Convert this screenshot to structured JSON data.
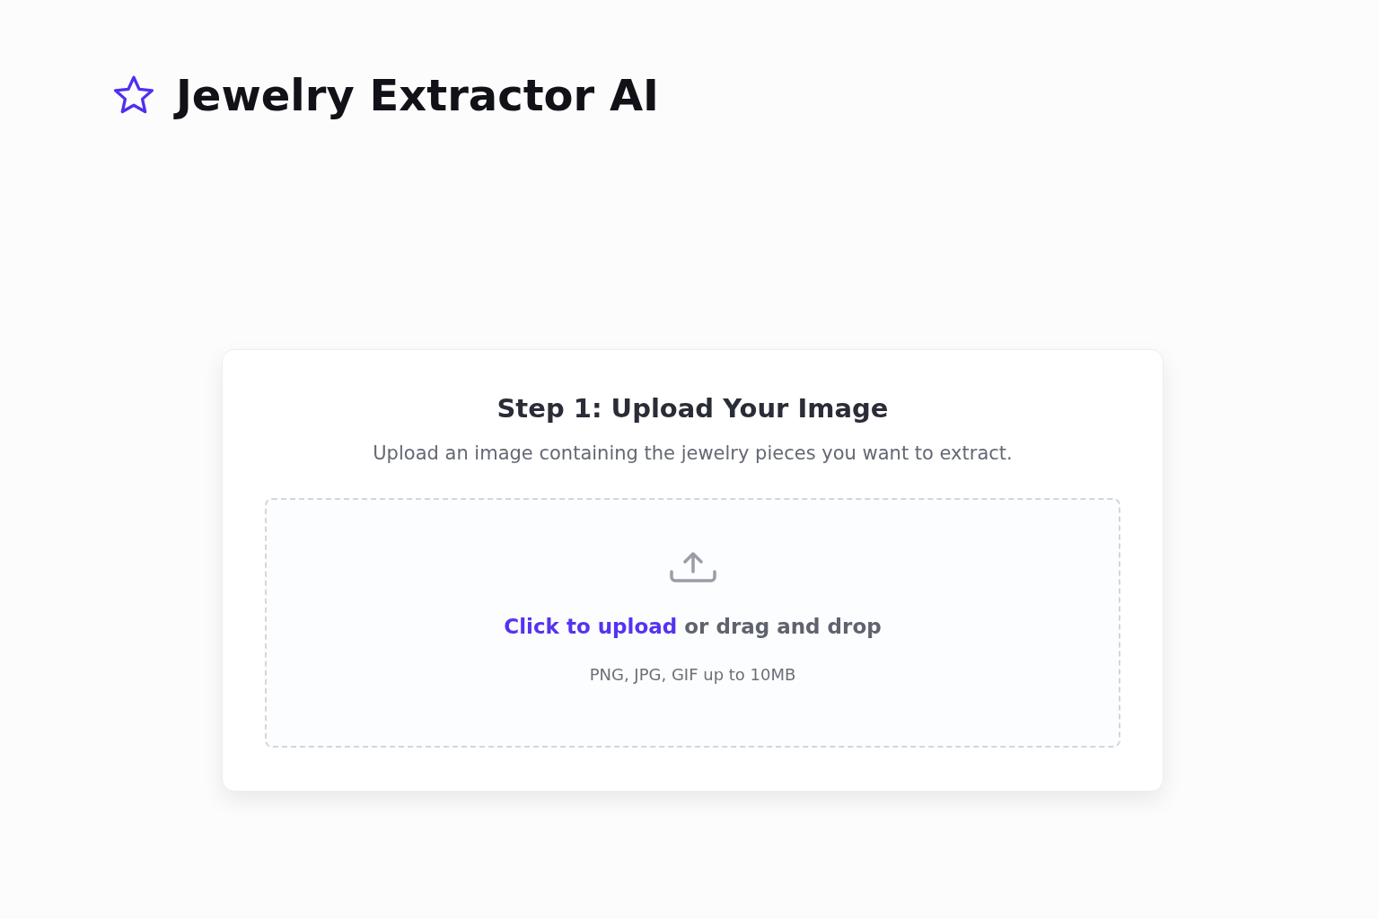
{
  "header": {
    "title": "Jewelry Extractor AI"
  },
  "upload_card": {
    "title": "Step 1: Upload Your Image",
    "description": "Upload an image containing the jewelry pieces you want to extract.",
    "dropzone": {
      "link": "Click to upload",
      "text": "or drag and drop",
      "hint": "PNG, JPG, GIF up to 10MB"
    }
  }
}
